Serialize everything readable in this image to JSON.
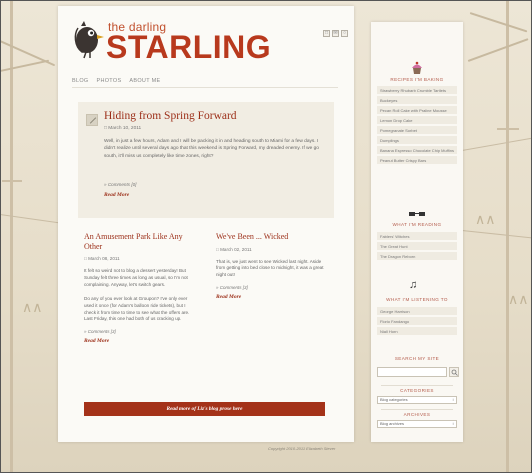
{
  "site": {
    "logo_small": "the darling",
    "logo_big": "STARLING",
    "nav": [
      "BLOG",
      "PHOTOS",
      "ABOUT ME"
    ],
    "social_icons": [
      "rss-icon",
      "email-icon",
      "share-icon"
    ]
  },
  "featured": {
    "title": "Hiding from Spring Forward",
    "date": "March 10, 2011",
    "body": "Well, in just a few hours, Adam and I will be packing it in and heading south to Miami for a few days. I didn't realize until several days ago that this weekend is Spring Forward, my dreaded enemy. If we go south, it'll miss us completely like time zones, right?",
    "comments": "Comments [0]",
    "read_more": "Read More"
  },
  "posts": [
    {
      "title": "An Amusement Park Like Any Other",
      "date": "March 08, 2011",
      "p1": "It felt so weird not to blog a dessert yesterday! But Sunday felt three times as long as usual, so I'm not complaining. Anyway, let's switch gears.",
      "p2": "Do any of you ever look at Groupon? I've only ever used it once (for Adam's balloon ride tickets), but I check it from time to time to see what the offers are. Last Friday, this one had both of us cracking up.",
      "comments": "Comments [3]",
      "read_more": "Read More"
    },
    {
      "title": "We've Been ... Wicked",
      "date": "March 02, 2011",
      "p1": "That is, we just went to see Wicked last night. Aside from getting into bed close to midnight, it was a great night out!",
      "p2": "",
      "comments": "Comments [3]",
      "read_more": "Read More"
    }
  ],
  "more_button": "Read more of Liz's blog prose here",
  "copyright": "Copyright 2010-2011 Elizabeth Stever",
  "sidebar": {
    "baking_head": "RECIPES I'M BAKING",
    "baking_items": [
      "Strawberry Rhubarb Crumble Tartlets",
      "Buckeyes",
      "Pecan Roll Cake with Praline Mousse",
      "Lemon Drop Cake",
      "Pomegranate Sorbet",
      "Dumplings",
      "Banana Espresso Chocolate Chip Muffins",
      "Peanut Butter Crispy Bars"
    ],
    "reading_head": "WHAT I'M READING",
    "reading_items": [
      "Fablers' Witches",
      "The Great Hunt",
      "The Dragon Reborn"
    ],
    "listening_head": "WHAT I'M LISTENING TO",
    "listening_items": [
      "George Harrison",
      "Florio Fandango",
      "Niall Horn"
    ],
    "search_head": "SEARCH MY SITE",
    "categories_head": "CATEGORIES",
    "categories_value": "Blog categories",
    "archives_head": "ARCHIVES",
    "archives_value": "Blog archives"
  },
  "colors": {
    "brand": "#b8391d",
    "button": "#a43219",
    "heading": "#b35a4a"
  }
}
